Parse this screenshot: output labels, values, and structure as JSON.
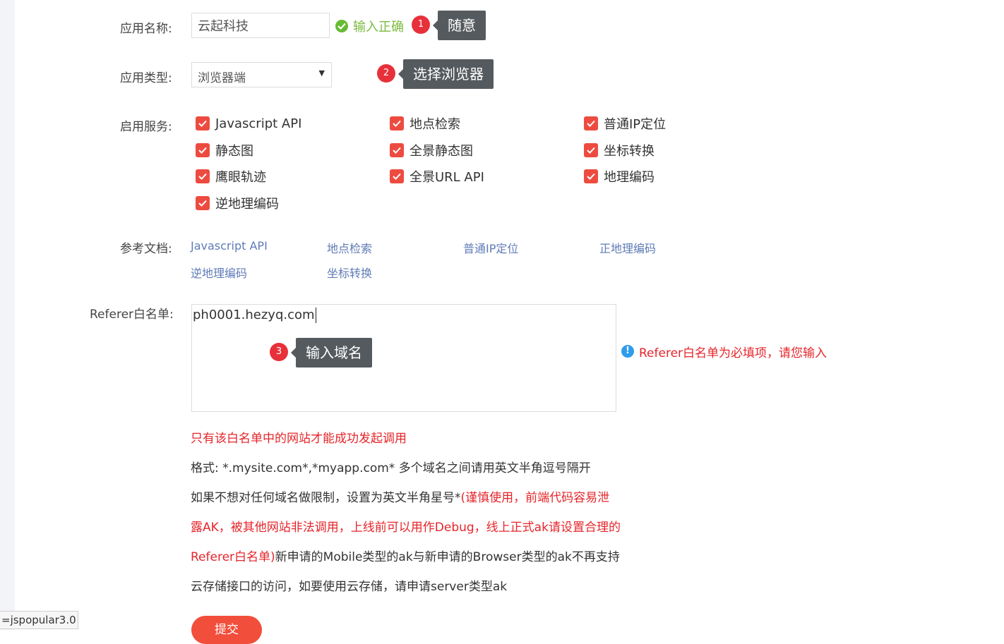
{
  "form": {
    "app_name_label": "应用名称:",
    "app_name_value": "云起科技",
    "app_name_valid": "输入正确",
    "app_type_label": "应用类型:",
    "app_type_value": "浏览器端",
    "services_label": "启用服务:",
    "services": [
      {
        "label": "Javascript API",
        "checked": true
      },
      {
        "label": "地点检索",
        "checked": true
      },
      {
        "label": "普通IP定位",
        "checked": true
      },
      {
        "label": "静态图",
        "checked": true
      },
      {
        "label": "全景静态图",
        "checked": true
      },
      {
        "label": "坐标转换",
        "checked": true
      },
      {
        "label": "鹰眼轨迹",
        "checked": true
      },
      {
        "label": "全景URL API",
        "checked": true
      },
      {
        "label": "地理编码",
        "checked": true
      },
      {
        "label": "逆地理编码",
        "checked": true
      }
    ],
    "docs_label": "参考文档:",
    "docs": [
      "Javascript API",
      "地点检索",
      "普通IP定位",
      "正地理编码",
      "逆地理编码",
      "坐标转换"
    ],
    "referer_label": "Referer白名单:",
    "referer_value": "ph0001.hezyq.com",
    "referer_error": "Referer白名单为必填项，请您输入",
    "notes": {
      "line1": "只有该白名单中的网站才能成功发起调用",
      "line2": "格式: *.mysite.com*,*myapp.com* 多个域名之间请用英文半角逗号隔开",
      "line3_black": "如果不想对任何域名做限制，设置为英文半角星号*",
      "line3_red": "(谨慎使用，前端代码容易泄",
      "line4_red": "露AK，被其他网站非法调用，上线前可以用作Debug，线上正式ak请设置合理的",
      "line5_red": "Referer白名单)",
      "line5_black": "新申请的Mobile类型的ak与新申请的Browser类型的ak不再支持",
      "line6": "云存储接口的访问，如要使用云存储，请申请server类型ak"
    },
    "submit_label": "提交"
  },
  "annotations": [
    {
      "number": "1",
      "text": "随意"
    },
    {
      "number": "2",
      "text": "选择浏览器"
    },
    {
      "number": "3",
      "text": "输入域名"
    }
  ],
  "status_bar": "=jspopular3.0",
  "colors": {
    "checkbox": "#ee4b40",
    "link": "#5f7bb6",
    "error": "#e5252a",
    "success": "#7cbb3f",
    "badge": "#e8303a",
    "tooltip": "#555a5e",
    "submit": "#f24e3c"
  }
}
